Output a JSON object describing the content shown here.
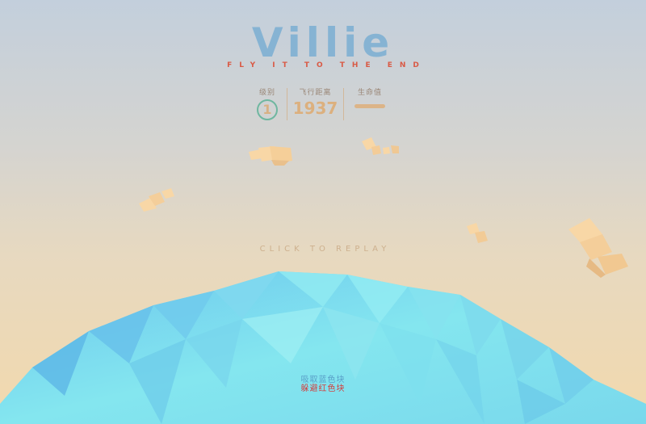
{
  "game": {
    "title": "Villie",
    "subtitle": "FLY IT TO THE END",
    "replay_prompt": "CLICK TO REPLAY"
  },
  "hud": {
    "level_label": "级别",
    "level_value": "1",
    "distance_label": "飞行距离",
    "distance_value": "1937",
    "life_label": "生命值",
    "life_fraction": 1.0
  },
  "hints": {
    "collect": "吸取蓝色块",
    "avoid": "躲避红色块"
  },
  "colors": {
    "title": "#86b3d3",
    "subtitle": "#d95a45",
    "level_ring": "#6fb7a0",
    "hud_value": "#dcb07e",
    "collect_hint": "#5aa0c8",
    "avoid_hint": "#d23d3d",
    "planet": "#7ee3ee",
    "clouds": "#f8d7a6"
  },
  "icons": {
    "level": "level-ring-icon",
    "life": "life-bar-icon"
  }
}
